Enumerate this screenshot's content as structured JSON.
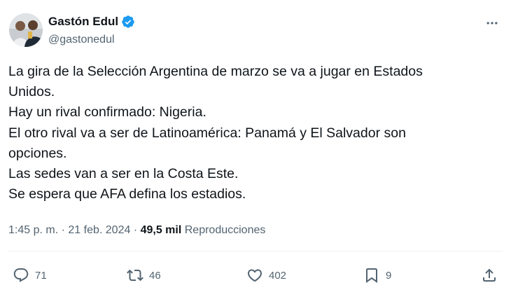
{
  "author": {
    "display_name": "Gastón Edul",
    "handle": "@gastonedul",
    "verified_color": "#1d9bf0"
  },
  "tweet": {
    "lines": [
      "La gira de la Selección Argentina de marzo se va a jugar en Estados",
      "Unidos.",
      "Hay un rival confirmado: Nigeria.",
      "El otro rival va a ser de Latinoamérica: Panamá y El Salvador son",
      "opciones.",
      "Las sedes van a ser en la Costa Este.",
      "Se espera que AFA defina los estadios."
    ],
    "time": "1:45 p. m.",
    "separator": "·",
    "date": "21 feb. 2024",
    "views_count": "49,5 mil",
    "views_label": "Reproducciones"
  },
  "actions": {
    "replies": "71",
    "retweets": "46",
    "likes": "402",
    "bookmarks": "9"
  },
  "icons": {
    "more": "more-icon",
    "reply": "reply-icon",
    "retweet": "retweet-icon",
    "like": "heart-icon",
    "bookmark": "bookmark-icon",
    "share": "share-icon"
  },
  "colors": {
    "text": "#0f1419",
    "secondary": "#536471",
    "accent": "#1d9bf0"
  }
}
